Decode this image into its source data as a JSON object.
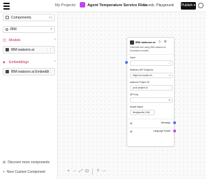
{
  "header": {
    "breadcrumb_projects": "My Projects",
    "breadcrumb_sep": "/",
    "flow_name": "Agent Temperature Service Flow",
    "saved_status": "Saved",
    "playground_button": "Playground",
    "publish_button": "Publish",
    "project_icon_color": "#c742e8"
  },
  "sidebar": {
    "components_title": "Components",
    "search_value": "IBM",
    "categories": {
      "models": "Models",
      "embeddings": "Embeddings"
    },
    "items": {
      "models_item": "IBM watsonx.ai",
      "embeddings_item": "IBM watsonx.ai Embeddings"
    },
    "footer_links": {
      "discover": "Discover more components",
      "new_component": "New Custom Component"
    },
    "accent_color": "#c7284c"
  },
  "node": {
    "title": "IBM watsonx.ai",
    "description": "Generate text using IBM watsonx.ai foundation models.",
    "fields": {
      "input_label": "Input",
      "watsonx_api_label": "Watsonx API Endpoint",
      "watsonx_api_value": "https://us-south.ml...",
      "project_id_label": "watsonx Project ID",
      "project_id_value": "your-project-id",
      "api_key_label": "API Key",
      "model_name_label": "Model Name",
      "model_name_value": "ibm/granite-3-8b"
    },
    "outputs": {
      "message": "Message",
      "language_model": "Language Model"
    },
    "handle_colors": {
      "input": "#4f6bed",
      "message": "#4f6bed",
      "language_model": "#c742e8"
    }
  },
  "canvas_toolbar": {
    "zoom_in": "+",
    "zoom_out": "−",
    "fit": "⤢",
    "lock": "⊡",
    "help": "?",
    "more": "⋯"
  }
}
